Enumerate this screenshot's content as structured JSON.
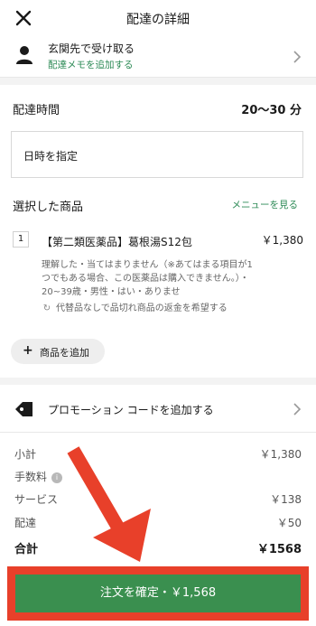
{
  "header": {
    "title": "配達の詳細",
    "close_icon": "close-icon"
  },
  "delivery": {
    "option": "玄関先で受け取る",
    "memo_link": "配達メモを追加する",
    "link_color": "#2e8b57"
  },
  "time": {
    "label": "配達時間",
    "value": "20〜30 分",
    "schedule": "日時を指定"
  },
  "items": {
    "title": "選択した商品",
    "view_menu": "メニューを見る",
    "list": [
      {
        "qty": "1",
        "name": "【第二類医薬品】葛根湯S12包",
        "price": "￥1,380",
        "desc": "理解した・当てはまりません（※あてはまる項目が1つでもある場合、この医薬品は購入できません。）・20~39歳・男性・はい・ありませ",
        "refund": "代替品なしで品切れ商品の返金を希望する"
      }
    ],
    "add_label": "商品を追加"
  },
  "promo": {
    "label": "プロモーション コードを追加する"
  },
  "summary": {
    "subtotal_label": "小計",
    "subtotal": "￥1,380",
    "fee_label": "手数料",
    "service_label": "サービス",
    "service": "￥138",
    "delivery_label": "配達",
    "delivery": "￥50",
    "total_label": "合計",
    "total": "￥1568"
  },
  "cta": {
    "label": "注文を確定・￥1,568",
    "color": "#3a8f4f"
  },
  "annotation": {
    "color": "#e8402a"
  }
}
